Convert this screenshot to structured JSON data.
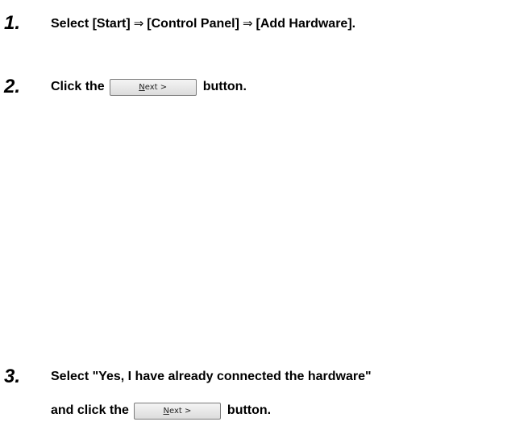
{
  "steps": [
    {
      "number": "1.",
      "parts": [
        "Select [Start]",
        "[Control Panel]",
        "[Add Hardware]."
      ]
    },
    {
      "number": "2.",
      "before": "Click the",
      "after": "button."
    },
    {
      "number": "3.",
      "line1": "Select \"Yes, I have already connected the hardware\"",
      "before": "and click the",
      "after": "button."
    }
  ],
  "arrow_glyph": "⇒",
  "next_button": {
    "mnemonic": "N",
    "rest": "ext",
    "suffix": " >"
  }
}
